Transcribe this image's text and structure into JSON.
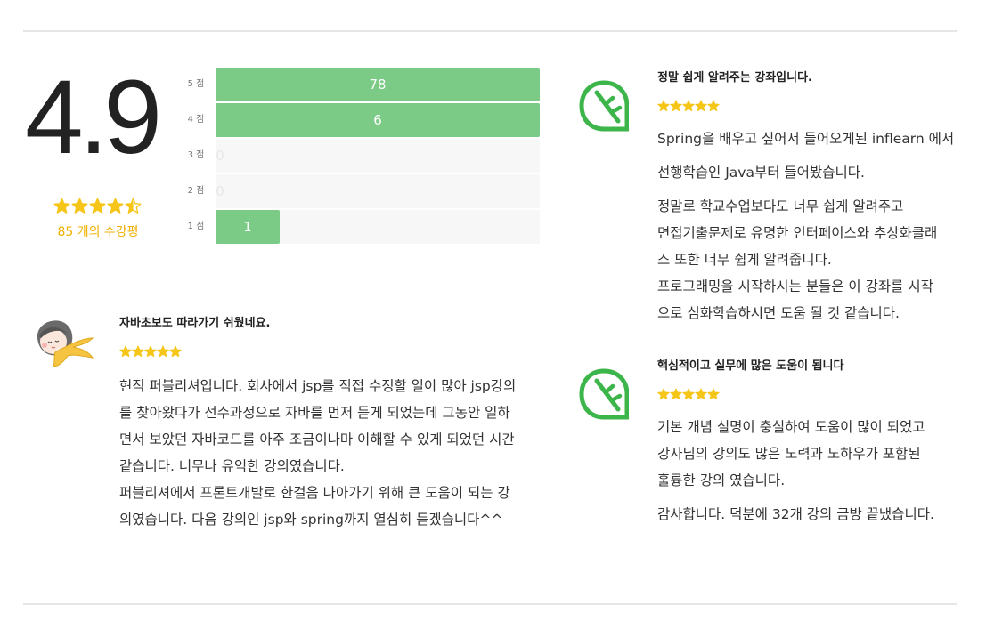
{
  "rating_summary": {
    "average": "4.9",
    "average_value": 4.9,
    "count_text": "85 개의 수강평",
    "star_color": "#f5c518",
    "bar_color": "#7bca85",
    "distribution": [
      {
        "label": "5 점",
        "count": "78",
        "fraction": 1.0
      },
      {
        "label": "4 점",
        "count": "6",
        "fraction": 1.0
      },
      {
        "label": "3 점",
        "count": "0",
        "fraction": 0
      },
      {
        "label": "2 점",
        "count": "0",
        "fraction": 0
      },
      {
        "label": "1 점",
        "count": "1",
        "fraction": 0.2
      }
    ]
  },
  "reviews": [
    {
      "avatar": "leaf-logo-icon",
      "title": "정말 쉽게 알려주는 강좌입니다.",
      "rating": 5,
      "paragraphs": [
        [
          "Spring을 배우고 싶어서 들어오게된 inflearn 에서"
        ],
        [
          "선행학습인 Java부터 들어봤습니다."
        ],
        [
          "정말로 학교수업보다도 너무 쉽게 알려주고",
          "면접기출문제로 유명한 인터페이스와 추상화클래",
          "스 또한 너무 쉽게 알려줍니다.",
          "프로그래밍을 시작하시는 분들은 이 강좌를 시작",
          "으로 심화학습하시면 도움 될 것 같습니다."
        ]
      ]
    },
    {
      "avatar": "leaf-logo-icon",
      "title": "핵심적이고 실무에 많은 도움이 됩니다",
      "rating": 5,
      "paragraphs": [
        [
          "기본 개념 설명이 충실하여 도움이 많이 되었고",
          "강사님의 강의도 많은 노력과 노하우가 포함된",
          "훌륭한 강의 였습니다."
        ],
        [
          "감사합니다. 덕분에 32개 강의 금방 끝냈습니다."
        ]
      ]
    },
    {
      "avatar": "user-avatar-illustration",
      "title": "자바초보도 따라가기 쉬웠네요.",
      "rating": 5,
      "paragraphs": [
        [
          "현직 퍼블리셔입니다. 회사에서 jsp를 직접 수정할 일이 많아 jsp강의",
          "를 찾아왔다가 선수과정으로 자바를 먼저 듣게 되었는데 그동안 일하",
          "면서 보았던 자바코드를 아주 조금이나마 이해할 수 있게 되었던 시간",
          "같습니다. 너무나 유익한 강의였습니다.",
          "퍼블리셔에서 프론트개발로 한걸음 나아가기 위해 큰 도움이 되는 강",
          "의였습니다. 다음 강의인 jsp와 spring까지 열심히 듣겠습니다^^"
        ]
      ]
    }
  ]
}
